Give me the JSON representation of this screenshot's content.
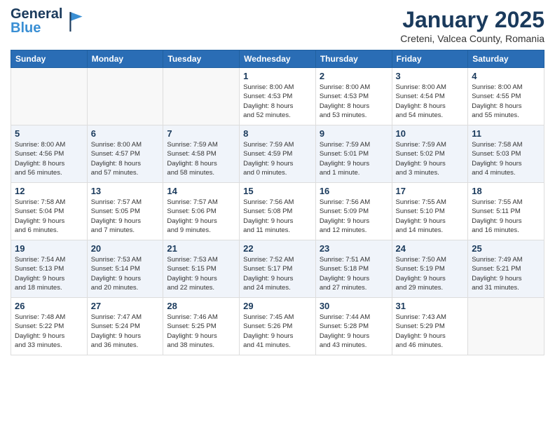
{
  "header": {
    "logo_general": "General",
    "logo_blue": "Blue",
    "month_title": "January 2025",
    "location": "Creteni, Valcea County, Romania"
  },
  "weekdays": [
    "Sunday",
    "Monday",
    "Tuesday",
    "Wednesday",
    "Thursday",
    "Friday",
    "Saturday"
  ],
  "weeks": [
    {
      "shaded": false,
      "days": [
        {
          "num": "",
          "info": ""
        },
        {
          "num": "",
          "info": ""
        },
        {
          "num": "",
          "info": ""
        },
        {
          "num": "1",
          "info": "Sunrise: 8:00 AM\nSunset: 4:53 PM\nDaylight: 8 hours\nand 52 minutes."
        },
        {
          "num": "2",
          "info": "Sunrise: 8:00 AM\nSunset: 4:53 PM\nDaylight: 8 hours\nand 53 minutes."
        },
        {
          "num": "3",
          "info": "Sunrise: 8:00 AM\nSunset: 4:54 PM\nDaylight: 8 hours\nand 54 minutes."
        },
        {
          "num": "4",
          "info": "Sunrise: 8:00 AM\nSunset: 4:55 PM\nDaylight: 8 hours\nand 55 minutes."
        }
      ]
    },
    {
      "shaded": true,
      "days": [
        {
          "num": "5",
          "info": "Sunrise: 8:00 AM\nSunset: 4:56 PM\nDaylight: 8 hours\nand 56 minutes."
        },
        {
          "num": "6",
          "info": "Sunrise: 8:00 AM\nSunset: 4:57 PM\nDaylight: 8 hours\nand 57 minutes."
        },
        {
          "num": "7",
          "info": "Sunrise: 7:59 AM\nSunset: 4:58 PM\nDaylight: 8 hours\nand 58 minutes."
        },
        {
          "num": "8",
          "info": "Sunrise: 7:59 AM\nSunset: 4:59 PM\nDaylight: 9 hours\nand 0 minutes."
        },
        {
          "num": "9",
          "info": "Sunrise: 7:59 AM\nSunset: 5:01 PM\nDaylight: 9 hours\nand 1 minute."
        },
        {
          "num": "10",
          "info": "Sunrise: 7:59 AM\nSunset: 5:02 PM\nDaylight: 9 hours\nand 3 minutes."
        },
        {
          "num": "11",
          "info": "Sunrise: 7:58 AM\nSunset: 5:03 PM\nDaylight: 9 hours\nand 4 minutes."
        }
      ]
    },
    {
      "shaded": false,
      "days": [
        {
          "num": "12",
          "info": "Sunrise: 7:58 AM\nSunset: 5:04 PM\nDaylight: 9 hours\nand 6 minutes."
        },
        {
          "num": "13",
          "info": "Sunrise: 7:57 AM\nSunset: 5:05 PM\nDaylight: 9 hours\nand 7 minutes."
        },
        {
          "num": "14",
          "info": "Sunrise: 7:57 AM\nSunset: 5:06 PM\nDaylight: 9 hours\nand 9 minutes."
        },
        {
          "num": "15",
          "info": "Sunrise: 7:56 AM\nSunset: 5:08 PM\nDaylight: 9 hours\nand 11 minutes."
        },
        {
          "num": "16",
          "info": "Sunrise: 7:56 AM\nSunset: 5:09 PM\nDaylight: 9 hours\nand 12 minutes."
        },
        {
          "num": "17",
          "info": "Sunrise: 7:55 AM\nSunset: 5:10 PM\nDaylight: 9 hours\nand 14 minutes."
        },
        {
          "num": "18",
          "info": "Sunrise: 7:55 AM\nSunset: 5:11 PM\nDaylight: 9 hours\nand 16 minutes."
        }
      ]
    },
    {
      "shaded": true,
      "days": [
        {
          "num": "19",
          "info": "Sunrise: 7:54 AM\nSunset: 5:13 PM\nDaylight: 9 hours\nand 18 minutes."
        },
        {
          "num": "20",
          "info": "Sunrise: 7:53 AM\nSunset: 5:14 PM\nDaylight: 9 hours\nand 20 minutes."
        },
        {
          "num": "21",
          "info": "Sunrise: 7:53 AM\nSunset: 5:15 PM\nDaylight: 9 hours\nand 22 minutes."
        },
        {
          "num": "22",
          "info": "Sunrise: 7:52 AM\nSunset: 5:17 PM\nDaylight: 9 hours\nand 24 minutes."
        },
        {
          "num": "23",
          "info": "Sunrise: 7:51 AM\nSunset: 5:18 PM\nDaylight: 9 hours\nand 27 minutes."
        },
        {
          "num": "24",
          "info": "Sunrise: 7:50 AM\nSunset: 5:19 PM\nDaylight: 9 hours\nand 29 minutes."
        },
        {
          "num": "25",
          "info": "Sunrise: 7:49 AM\nSunset: 5:21 PM\nDaylight: 9 hours\nand 31 minutes."
        }
      ]
    },
    {
      "shaded": false,
      "days": [
        {
          "num": "26",
          "info": "Sunrise: 7:48 AM\nSunset: 5:22 PM\nDaylight: 9 hours\nand 33 minutes."
        },
        {
          "num": "27",
          "info": "Sunrise: 7:47 AM\nSunset: 5:24 PM\nDaylight: 9 hours\nand 36 minutes."
        },
        {
          "num": "28",
          "info": "Sunrise: 7:46 AM\nSunset: 5:25 PM\nDaylight: 9 hours\nand 38 minutes."
        },
        {
          "num": "29",
          "info": "Sunrise: 7:45 AM\nSunset: 5:26 PM\nDaylight: 9 hours\nand 41 minutes."
        },
        {
          "num": "30",
          "info": "Sunrise: 7:44 AM\nSunset: 5:28 PM\nDaylight: 9 hours\nand 43 minutes."
        },
        {
          "num": "31",
          "info": "Sunrise: 7:43 AM\nSunset: 5:29 PM\nDaylight: 9 hours\nand 46 minutes."
        },
        {
          "num": "",
          "info": ""
        }
      ]
    }
  ]
}
